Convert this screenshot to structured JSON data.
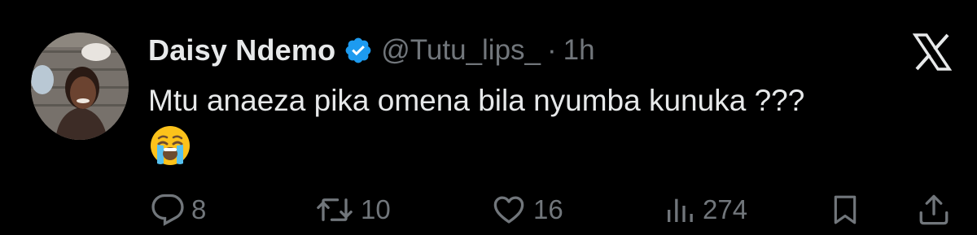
{
  "tweet": {
    "display_name": "Daisy Ndemo",
    "handle": "@Tutu_lips_",
    "separator": "·",
    "timestamp": "1h",
    "text": "Mtu anaeza pika omena bila nyumba kunuka ???",
    "emoji": "loudly-crying-face-emoji",
    "verified": true
  },
  "actions": {
    "replies": "8",
    "reposts": "10",
    "likes": "16",
    "views": "274"
  },
  "icons": {
    "verified": "verified-badge-icon",
    "platform": "x-logo-icon",
    "reply": "reply-icon",
    "repost": "repost-icon",
    "like": "like-icon",
    "views": "views-icon",
    "bookmark": "bookmark-icon",
    "share": "share-icon"
  },
  "colors": {
    "background": "#000000",
    "primary_text": "#e7e9ea",
    "secondary_text": "#71767b",
    "verified_blue": "#1d9bf0"
  }
}
